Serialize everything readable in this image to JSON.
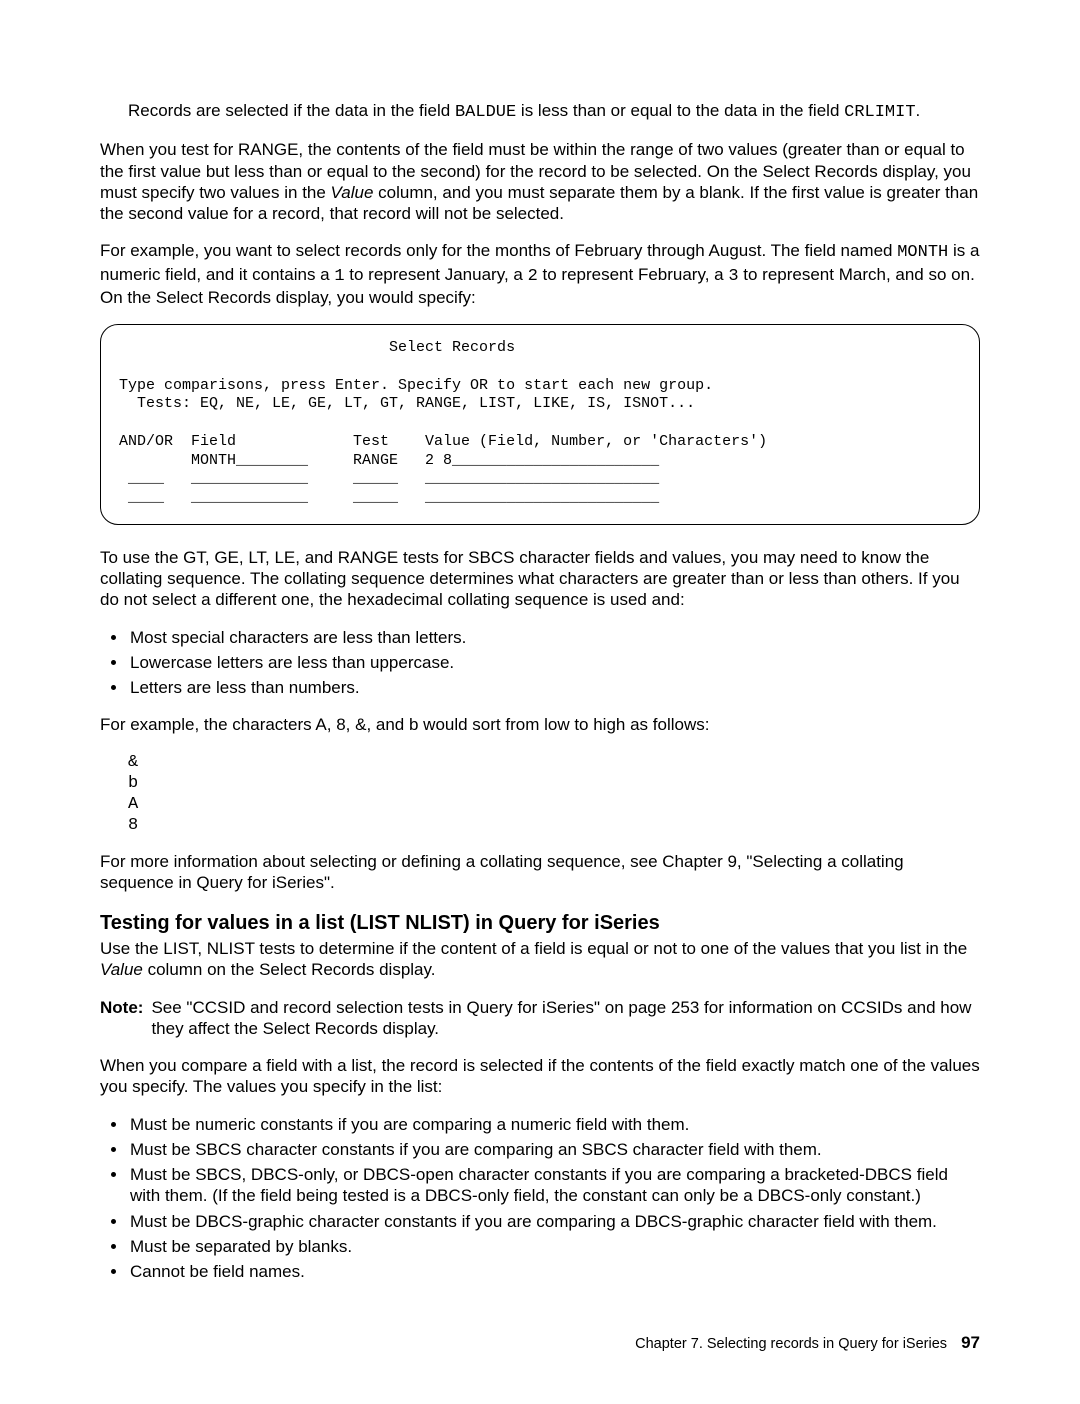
{
  "p_intro": {
    "pre": "Records are selected if the data in the field ",
    "code1": "BALDUE",
    "mid": " is less than or equal to the data in the field ",
    "code2": "CRLIMIT",
    "post": "."
  },
  "p_range": {
    "pre": "When you test for RANGE, the contents of the field must be within the range of two values (greater than or equal to the first value but less than or equal to the second) for the record to be selected. On the Select Records display, you must specify two values in the ",
    "ital": "Value",
    "post": " column, and you must separate them by a blank. If the first value is greater than the second value for a record, that record will not be selected."
  },
  "p_ex1": {
    "pre": "For example, you want to select records only for the months of February through August. The field named ",
    "code1": "MONTH",
    "mid1": " is a numeric field, and it contains a ",
    "code2": "1",
    "mid2": " to represent January, a ",
    "code3": "2",
    "mid3": " to represent February, a ",
    "code4": "3",
    "post": " to represent March, and so on. On the Select Records display, you would specify:"
  },
  "screen": "                              Select Records\n\nType comparisons, press Enter. Specify OR to start each new group.\n  Tests: EQ, NE, LE, GE, LT, GT, RANGE, LIST, LIKE, IS, ISNOT...\n\nAND/OR  Field             Test    Value (Field, Number, or 'Characters')\n        MONTH________     RANGE   2 8_______________________\n ____   _____________     _____   __________________________\n ____   _____________     _____   __________________________",
  "p_collating": "To use the GT, GE, LT, LE, and RANGE tests for SBCS character fields and values, you may need to know the collating sequence. The collating sequence determines what characters are greater than or less than others. If you do not select a different one, the hexadecimal collating sequence is used and:",
  "col_bullets": [
    "Most special characters are less than letters.",
    "Lowercase letters are less than uppercase.",
    "Letters are less than numbers."
  ],
  "p_sort_intro": "For example, the characters A, 8, &, and b would sort from low to high as follows:",
  "sort_block": "&\nb\nA\n8",
  "p_moreinfo": "For more information about selecting or defining a collating sequence, see Chapter 9, \"Selecting a collating sequence in Query for iSeries\".",
  "h2": "Testing for values in a list (LIST NLIST) in Query for iSeries",
  "p_list1": {
    "pre": "Use the LIST, NLIST tests to determine if the content of a field is equal or not to one of the values that you list in the ",
    "ital": "Value",
    "post": " column on the Select Records display."
  },
  "note_label": "Note:",
  "note_body": "See \"CCSID and record selection tests in Query for iSeries\" on page 253 for information on CCSIDs and how they affect the Select Records display.",
  "p_list2": "When you compare a field with a list, the record is selected if the contents of the field exactly match one of the values you specify. The values you specify in the list:",
  "list_bullets": [
    "Must be numeric constants if you are comparing a numeric field with them.",
    "Must be SBCS character constants if you are comparing an SBCS character field with them.",
    "Must be SBCS, DBCS-only, or DBCS-open character constants if you are comparing a bracketed-DBCS field with them. (If the field being tested is a DBCS-only field, the constant can only be a DBCS-only constant.)",
    "Must be DBCS-graphic character constants if you are comparing a DBCS-graphic character field with them.",
    "Must be separated by blanks.",
    "Cannot be field names."
  ],
  "footer_chapter": "Chapter 7. Selecting records in Query for iSeries",
  "footer_page": "97"
}
